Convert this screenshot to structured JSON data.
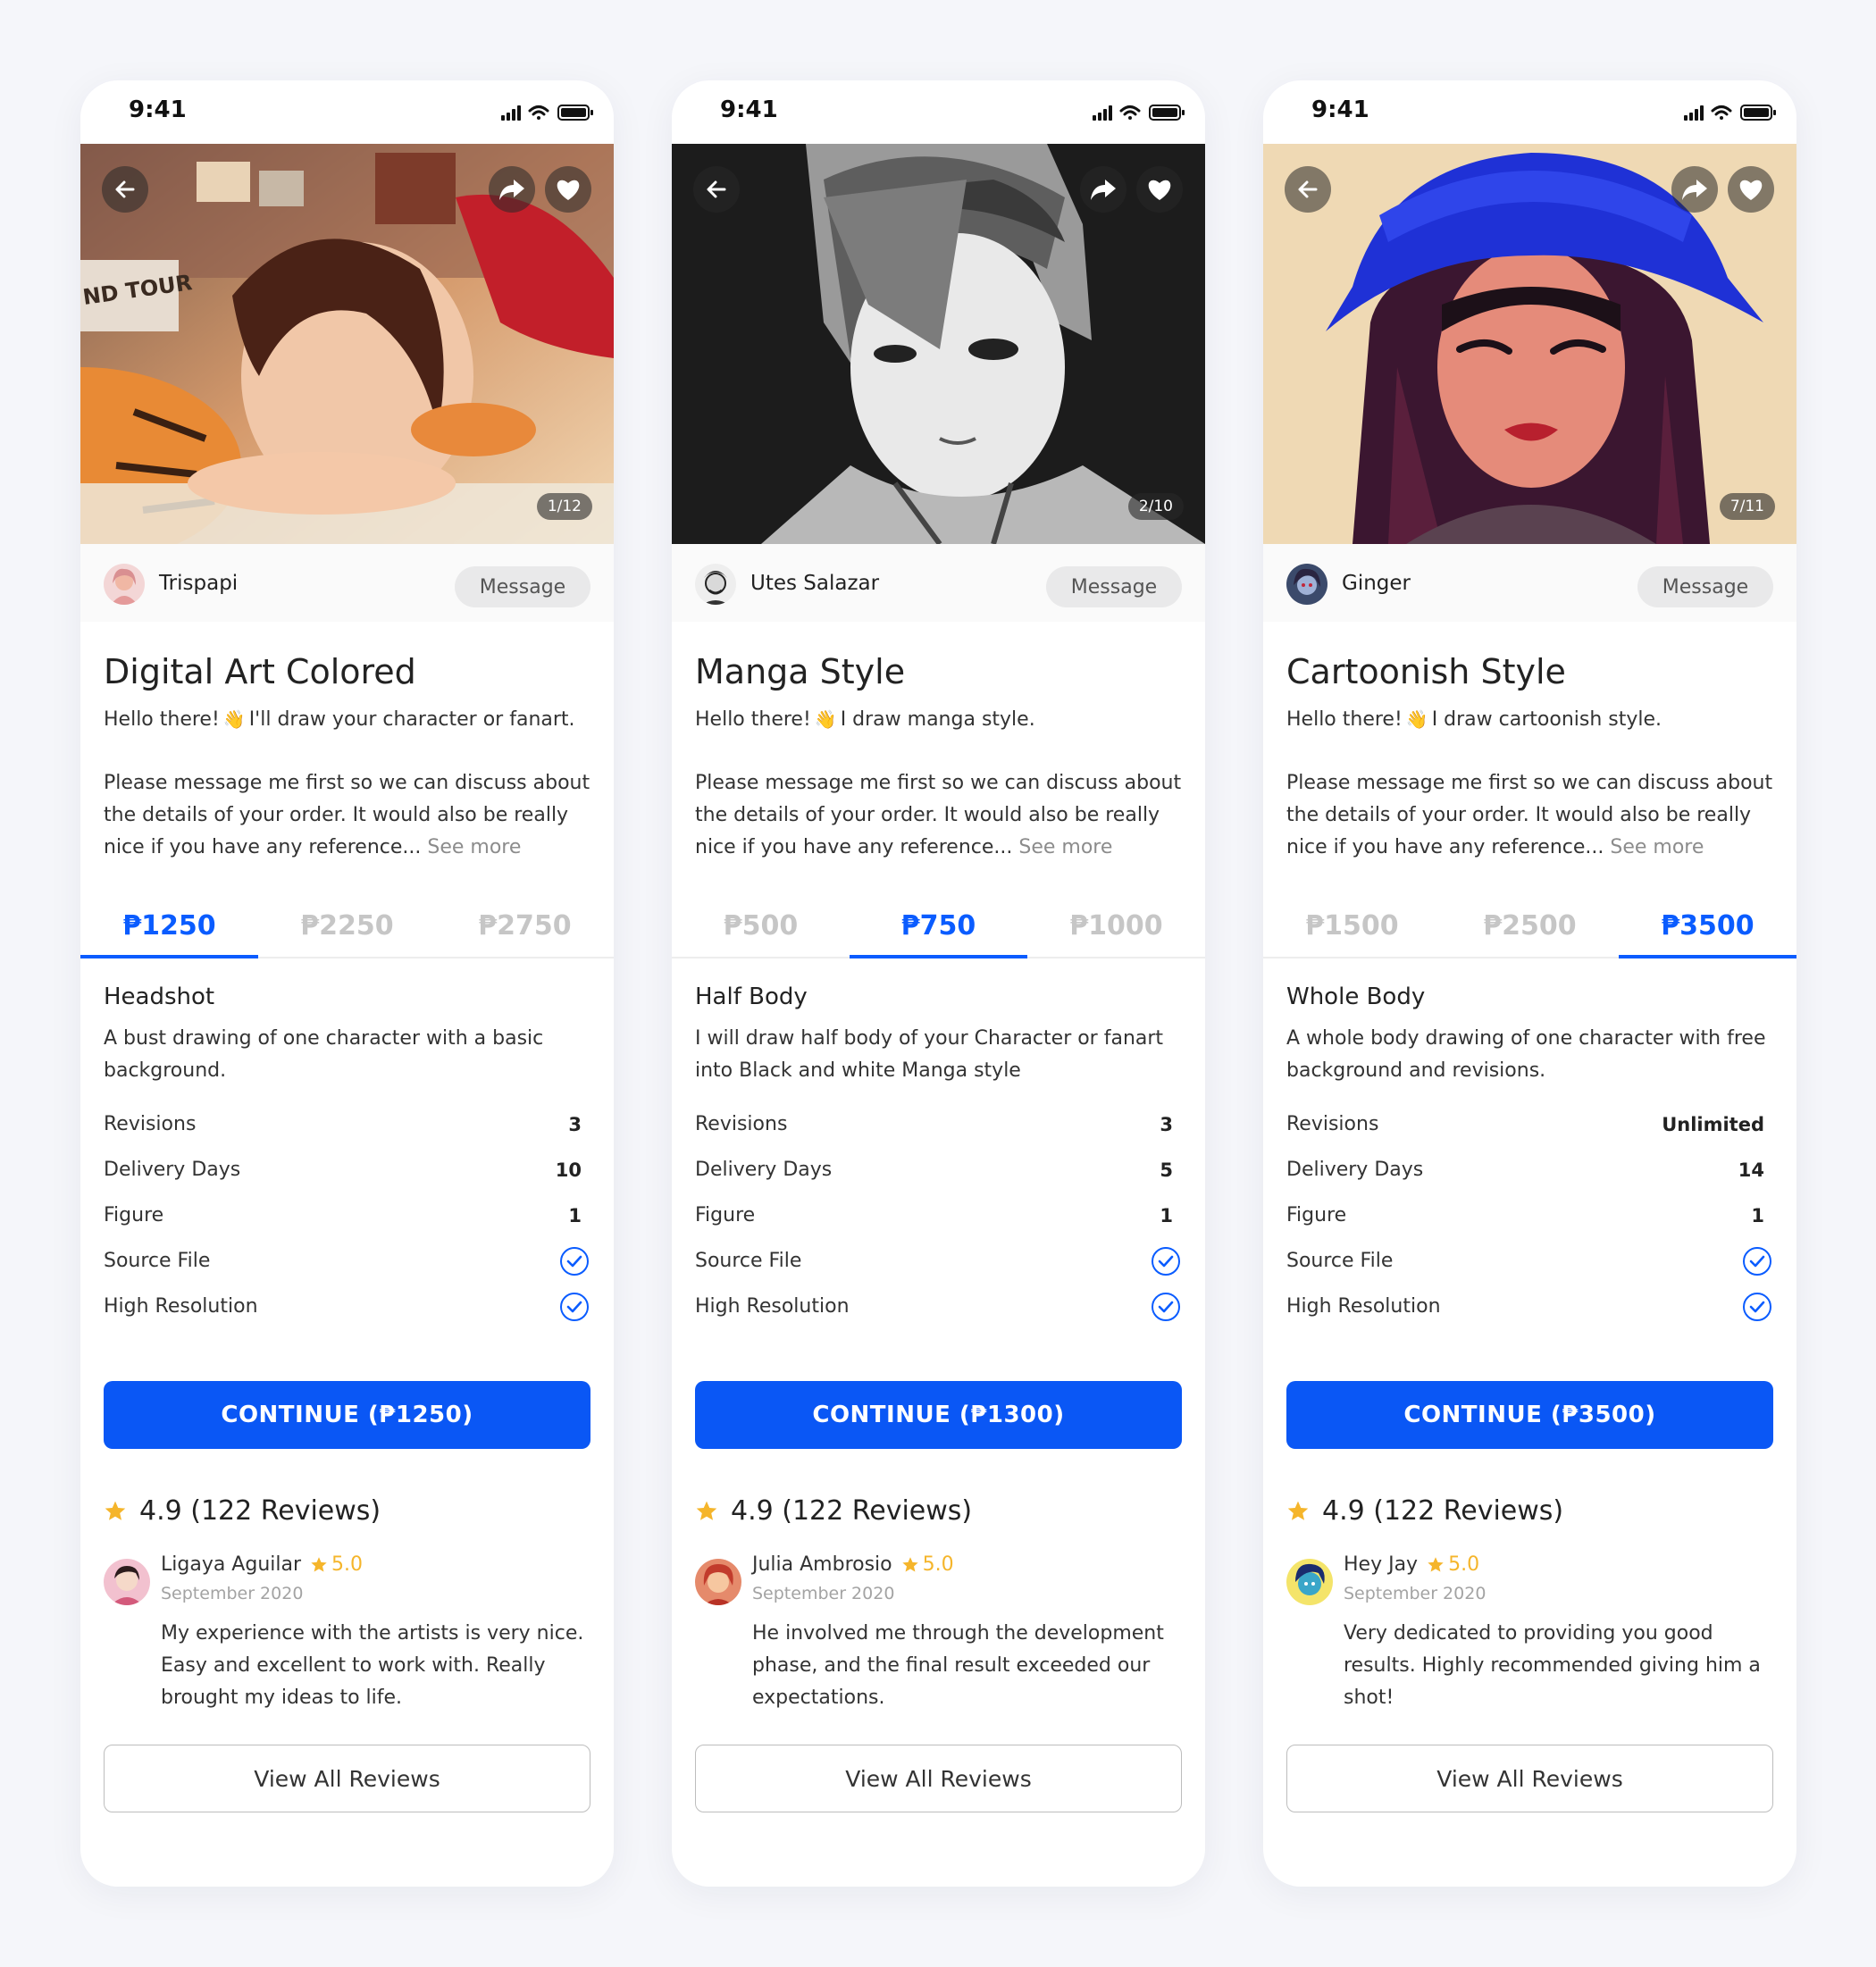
{
  "colors": {
    "accent": "#0a5cff",
    "star": "#f5b52b",
    "background": "#f5f6fa"
  },
  "icons": {
    "back": "arrow-left-icon",
    "share": "share-arrow-icon",
    "favorite": "heart-icon",
    "check": "check-circle-icon",
    "star": "star-icon",
    "signal": "signal-icon",
    "wifi": "wifi-icon",
    "battery": "battery-icon"
  },
  "phones": [
    {
      "status_time": "9:41",
      "image_counter": "1/12",
      "seller": {
        "name": "Trispapi",
        "message_label": "Message"
      },
      "title": "Digital Art Colored",
      "greeting_prefix": "Hello there!",
      "greeting_text": "I'll draw your character or fanart.",
      "description": "Please message me first so we can discuss about the details of your order. It would also be really nice if you have any reference...",
      "see_more": "See more",
      "tabs": [
        "₱1250",
        "₱2250",
        "₱2750"
      ],
      "active_tab": 0,
      "package": {
        "name": "Headshot",
        "description": "A bust drawing of one character with a basic background.",
        "rows": [
          {
            "label": "Revisions",
            "value": "3"
          },
          {
            "label": "Delivery Days",
            "value": "10"
          },
          {
            "label": "Figure",
            "value": "1"
          },
          {
            "label": "Source File",
            "value": ""
          },
          {
            "label": "High Resolution",
            "value": ""
          }
        ]
      },
      "continue_label": "CONTINUE (₱1250)",
      "rating_summary": "4.9 (122 Reviews)",
      "review": {
        "name": "Ligaya Aguilar",
        "score": "5.0",
        "date": "September 2020",
        "text": "My experience with the artists is very nice. Easy and excellent to work with. Really brought my ideas to life."
      },
      "view_all_label": "View All Reviews"
    },
    {
      "status_time": "9:41",
      "image_counter": "2/10",
      "seller": {
        "name": "Utes Salazar",
        "message_label": "Message"
      },
      "title": "Manga Style",
      "greeting_prefix": "Hello there!",
      "greeting_text": "I draw manga style.",
      "description": "Please message me first so we can discuss about the details of your order. It would also be really nice if you have any reference...",
      "see_more": "See more",
      "tabs": [
        "₱500",
        "₱750",
        "₱1000"
      ],
      "active_tab": 1,
      "package": {
        "name": "Half Body",
        "description": "I will draw half body of your Character or fanart into Black and white Manga style",
        "rows": [
          {
            "label": "Revisions",
            "value": "3"
          },
          {
            "label": "Delivery Days",
            "value": "5"
          },
          {
            "label": "Figure",
            "value": "1"
          },
          {
            "label": "Source File",
            "value": ""
          },
          {
            "label": "High Resolution",
            "value": ""
          }
        ]
      },
      "continue_label": "CONTINUE (₱1300)",
      "rating_summary": "4.9 (122 Reviews)",
      "review": {
        "name": "Julia Ambrosio",
        "score": "5.0",
        "date": "September 2020",
        "text": "He involved me through the development phase, and the final result exceeded our expectations."
      },
      "view_all_label": "View All Reviews"
    },
    {
      "status_time": "9:41",
      "image_counter": "7/11",
      "seller": {
        "name": "Ginger",
        "message_label": "Message"
      },
      "title": "Cartoonish Style",
      "greeting_prefix": "Hello there!",
      "greeting_text": "I draw cartoonish style.",
      "description": "Please message me first so we can discuss about the details of your order. It would also be really nice if you have any reference...",
      "see_more": "See more",
      "tabs": [
        "₱1500",
        "₱2500",
        "₱3500"
      ],
      "active_tab": 2,
      "package": {
        "name": "Whole Body",
        "description": "A whole body drawing of one character with free background and revisions.",
        "rows": [
          {
            "label": "Revisions",
            "value": "Unlimited"
          },
          {
            "label": "Delivery Days",
            "value": "14"
          },
          {
            "label": "Figure",
            "value": "1"
          },
          {
            "label": "Source File",
            "value": ""
          },
          {
            "label": "High Resolution",
            "value": ""
          }
        ]
      },
      "continue_label": "CONTINUE (₱3500)",
      "rating_summary": "4.9 (122 Reviews)",
      "review": {
        "name": "Hey Jay",
        "score": "5.0",
        "date": "September 2020",
        "text": "Very dedicated to providing you good results. Highly recommended giving him a shot!"
      },
      "view_all_label": "View All Reviews"
    }
  ]
}
